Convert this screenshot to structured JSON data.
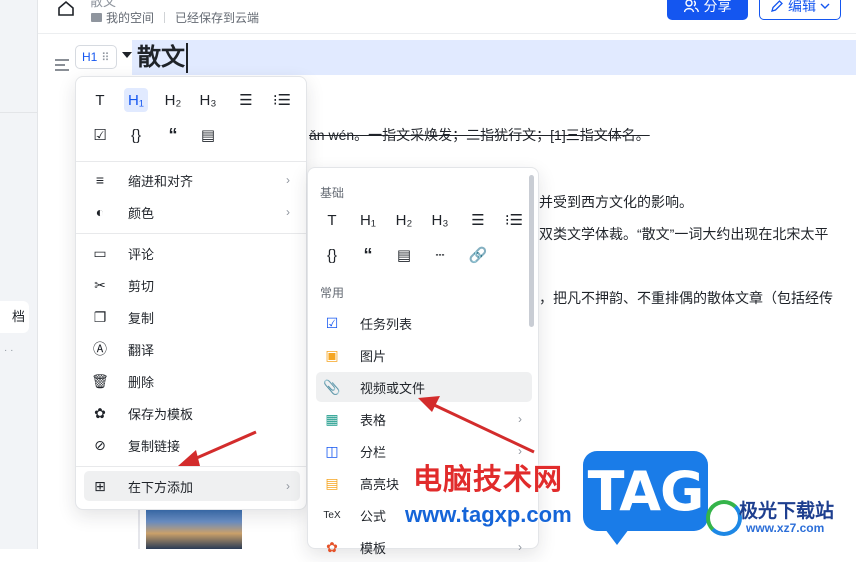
{
  "header": {
    "doc_title": "散文",
    "breadcrumb_space": "我的空间",
    "save_status": "已经保存到云端",
    "share_label": "分享",
    "edit_label": "编辑"
  },
  "sidebar": {
    "active_item_partial": "档",
    "dots": "· ·"
  },
  "document": {
    "heading": "散文",
    "lines": [
      "ǎn wén。一指文采焕发；二指犹行文；[1]三指文体名。",
      "并受到西方文化的影响。",
      "双类文学体裁。“散文”一词大约出现在北宋太平",
      "，把凡不押韵、不重排偶的散体文章（包括经传"
    ]
  },
  "block_menu": {
    "heading_chip": "H1",
    "toolbar_row1": [
      "T",
      "H1",
      "H2",
      "H3",
      "ol",
      "ul"
    ],
    "toolbar_row2": [
      "task",
      "{}",
      "quote",
      "callout"
    ],
    "items": [
      {
        "label": "缩进和对齐",
        "icon": "align-left-icon",
        "submenu": true
      },
      {
        "label": "颜色",
        "icon": "palette-icon",
        "submenu": true
      },
      {
        "label": "评论",
        "icon": "comment-icon",
        "submenu": false
      },
      {
        "label": "剪切",
        "icon": "scissors-icon",
        "submenu": false
      },
      {
        "label": "复制",
        "icon": "copy-icon",
        "submenu": false
      },
      {
        "label": "翻译",
        "icon": "translate-icon",
        "submenu": false
      },
      {
        "label": "删除",
        "icon": "trash-icon",
        "submenu": false
      },
      {
        "label": "保存为模板",
        "icon": "template-icon",
        "submenu": false
      },
      {
        "label": "复制链接",
        "icon": "link-copy-icon",
        "submenu": false
      },
      {
        "label": "在下方添加",
        "icon": "plus-square-icon",
        "submenu": true
      }
    ]
  },
  "add_menu": {
    "section_basic": "基础",
    "section_common": "常用",
    "basic_row1": [
      "T",
      "H1",
      "H2",
      "H3",
      "ol",
      "ul"
    ],
    "basic_row2": [
      "{}",
      "quote",
      "callout",
      "divider",
      "link"
    ],
    "items": [
      {
        "label": "任务列表",
        "icon": "checkbox-icon",
        "submenu": false
      },
      {
        "label": "图片",
        "icon": "image-icon",
        "submenu": false
      },
      {
        "label": "视频或文件",
        "icon": "paperclip-icon",
        "submenu": false
      },
      {
        "label": "表格",
        "icon": "table-icon",
        "submenu": true
      },
      {
        "label": "分栏",
        "icon": "columns-icon",
        "submenu": true
      },
      {
        "label": "高亮块",
        "icon": "highlight-icon",
        "submenu": false
      },
      {
        "label": "公式",
        "icon": "tex-icon",
        "submenu": false
      },
      {
        "label": "模板",
        "icon": "template-icon",
        "submenu": true
      }
    ]
  },
  "watermark": {
    "title": "电脑技术网",
    "url": "www.tagxp.com",
    "tag": "TAG",
    "site_name": "极光下载站",
    "site_url": "www.xz7.com"
  },
  "colors": {
    "accent": "#1456f0",
    "highlight": "#e1eaff",
    "annotation_red": "#d32c2c"
  }
}
